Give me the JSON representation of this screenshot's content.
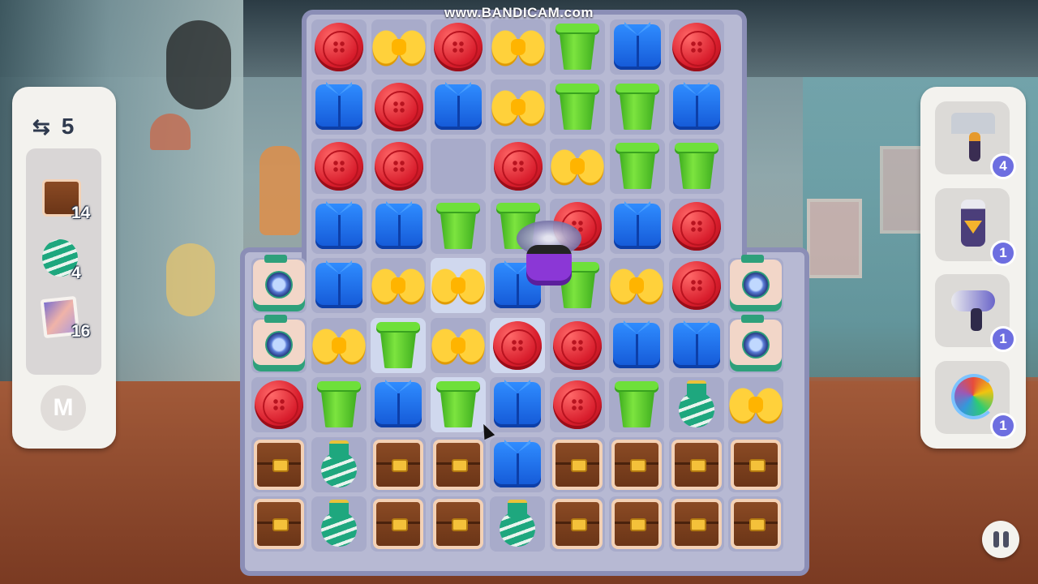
{
  "watermark": "www.BANDICAM.com",
  "moves": {
    "icon": "swap-arrows-icon",
    "value": "5"
  },
  "goals": [
    {
      "item": "chest",
      "count": "14"
    },
    {
      "item": "vase",
      "count": "4"
    },
    {
      "item": "photo",
      "count": "16"
    }
  ],
  "m_button_label": "M",
  "boosters": [
    {
      "name": "hammer",
      "count": "4"
    },
    {
      "name": "shaver",
      "count": "1"
    },
    {
      "name": "hair-dryer",
      "count": "1"
    },
    {
      "name": "shuffle",
      "count": "1"
    }
  ],
  "board": {
    "rows": [
      [
        "button",
        "bow",
        "button",
        "bow",
        "cup",
        "shirt",
        "button",
        "",
        ""
      ],
      [
        "shirt",
        "button",
        "shirt",
        "bow",
        "cup",
        "cup",
        "shirt",
        "",
        ""
      ],
      [
        "button",
        "button",
        "",
        "button",
        "bow",
        "cup",
        "cup",
        "",
        ""
      ],
      [
        "shirt",
        "shirt",
        "cup",
        "cup",
        "button",
        "shirt",
        "button",
        "",
        ""
      ],
      [
        "camera",
        "shirt",
        "bow",
        "bow",
        "shirt",
        "cup",
        "bow",
        "button",
        "camera"
      ],
      [
        "camera",
        "bow",
        "cup",
        "bow",
        "button",
        "button",
        "shirt",
        "shirt",
        "camera"
      ],
      [
        "button",
        "cup",
        "shirt",
        "cup",
        "shirt",
        "button",
        "cup",
        "vase",
        "bow"
      ],
      [
        "chest",
        "vase",
        "chest",
        "chest",
        "shirt",
        "chest",
        "chest",
        "chest",
        "chest"
      ],
      [
        "chest",
        "vase",
        "chest",
        "chest",
        "vase",
        "chest",
        "chest",
        "chest",
        "chest"
      ]
    ],
    "highlighted": [
      [
        4,
        3
      ],
      [
        5,
        2
      ],
      [
        5,
        4
      ],
      [
        6,
        3
      ]
    ]
  }
}
